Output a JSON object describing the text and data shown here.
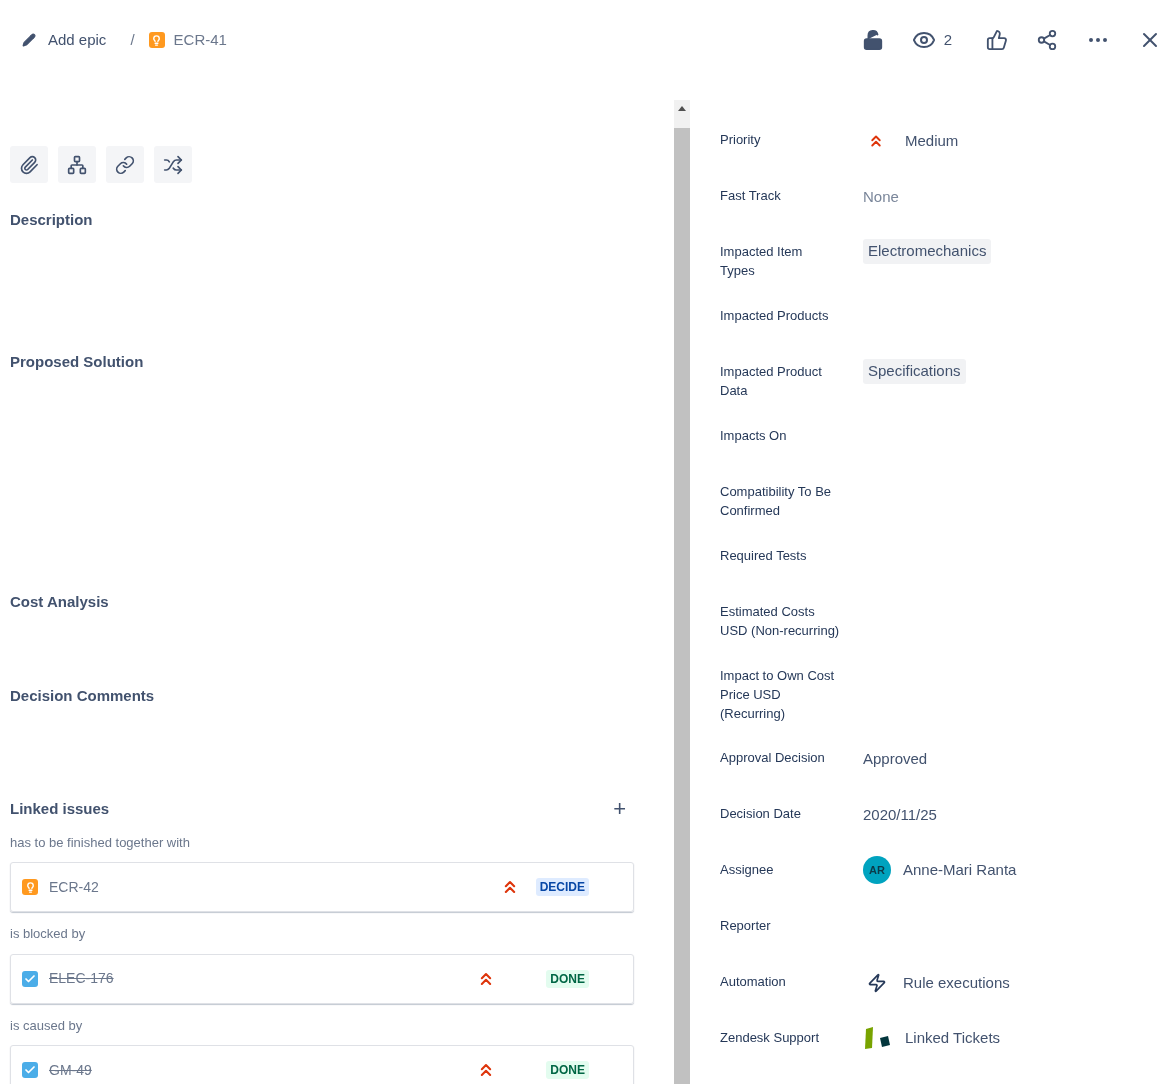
{
  "breadcrumb": {
    "epic_link": "Add epic",
    "separator": "/",
    "issue_key": "ECR-41"
  },
  "header_actions": {
    "watchers": "2"
  },
  "sections": [
    {
      "title": "Description"
    },
    {
      "title": "Proposed Solution"
    },
    {
      "title": "Cost Analysis"
    },
    {
      "title": "Decision Comments"
    }
  ],
  "linked_issues": {
    "title": "Linked issues",
    "add": "+",
    "groups": [
      {
        "relation": "has to be finished together with",
        "issue": {
          "kind": "idea",
          "key": "ECR-42",
          "resolved": false,
          "status": "DECIDE",
          "color": "#0747a6"
        }
      },
      {
        "relation": "is blocked by",
        "issue": {
          "kind": "task",
          "key": "ELEC-176",
          "resolved": true,
          "status": "DONE",
          "color": "#006644"
        }
      },
      {
        "relation": "is caused by",
        "issue": {
          "kind": "task",
          "key": "GM-49",
          "resolved": true,
          "status": "DONE",
          "color": "#006644"
        }
      }
    ]
  },
  "fields": [
    {
      "label": "Priority",
      "value": {
        "kind": "priority",
        "text": "Medium"
      }
    },
    {
      "label": "Fast Track",
      "value": {
        "kind": "empty",
        "text": "None"
      }
    },
    {
      "label": "Impacted Item Types",
      "value": {
        "kind": "tag",
        "text": "Electromechanics"
      }
    },
    {
      "label": "Impacted Products"
    },
    {
      "label": "Impacted Product Data",
      "value": {
        "kind": "tag",
        "text": "Specifications"
      }
    },
    {
      "label": "Impacts On"
    },
    {
      "label": "Compatibility To Be Confirmed"
    },
    {
      "label": "Required Tests"
    },
    {
      "label": "Estimated Costs USD (Non-recurring)"
    },
    {
      "label": "Impact to Own Cost Price USD (Recurring)"
    },
    {
      "label": "Approval Decision",
      "value": {
        "kind": "text",
        "text": "Approved"
      }
    },
    {
      "label": "Decision Date",
      "value": {
        "kind": "text",
        "text": "2020/11/25"
      }
    },
    {
      "label": "Assignee",
      "value": {
        "kind": "user",
        "initials": "AR",
        "text": "Anne-Mari Ranta"
      }
    },
    {
      "label": "Reporter"
    },
    {
      "label": "Automation",
      "value": {
        "kind": "automation",
        "text": "Rule executions"
      }
    },
    {
      "label": "Zendesk Support",
      "value": {
        "kind": "zendesk",
        "text": "Linked Tickets"
      }
    }
  ]
}
